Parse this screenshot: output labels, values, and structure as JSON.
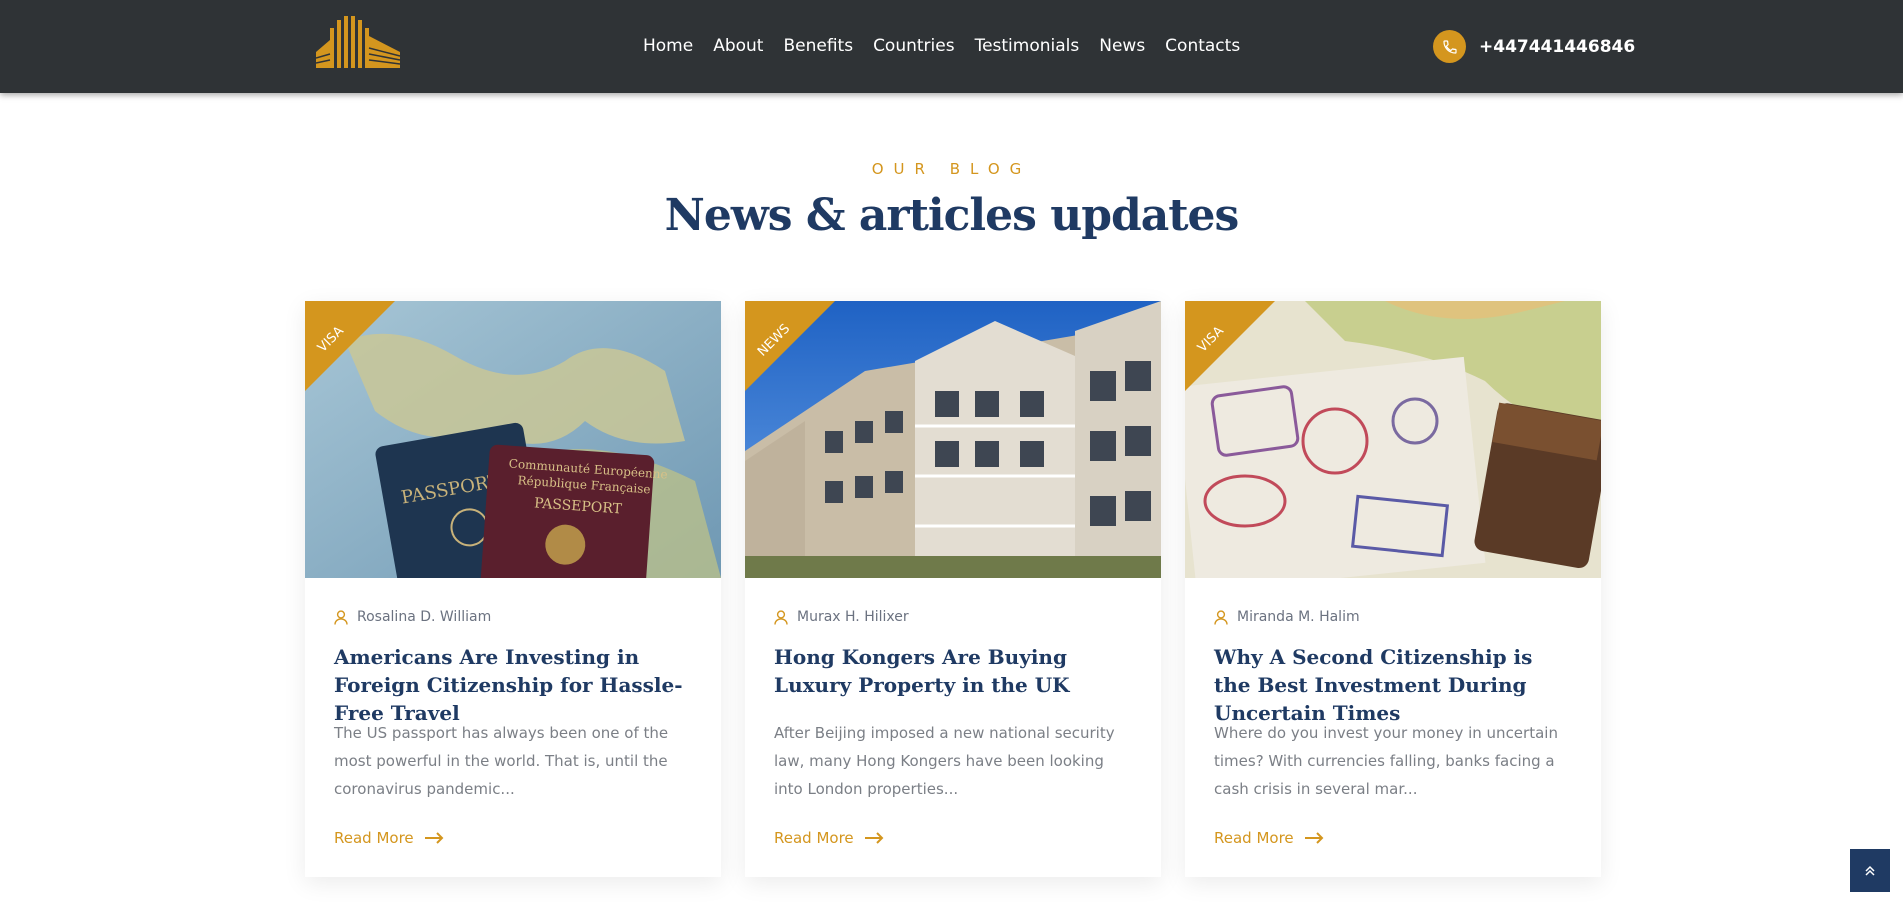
{
  "header": {
    "logo": "building-logo",
    "nav": [
      "Home",
      "About",
      "Benefits",
      "Countries",
      "Testimonials",
      "News",
      "Contacts"
    ],
    "phone": "+447441446846",
    "phone_icon": "phone-icon"
  },
  "section": {
    "eyebrow": "OUR BLOG",
    "title": "News & articles updates"
  },
  "posts": [
    {
      "tag": "VISA",
      "author": "Rosalina D. William",
      "title": "Americans Are Investing in Foreign Citizenship for Hassle-Free Travel",
      "excerpt": "The US passport has always been one of the most powerful in the world. That is, until the coronavirus pandemic...",
      "read_more": "Read More",
      "image_subject": "passports-on-map"
    },
    {
      "tag": "NEWS",
      "author": "Murax H. Hilixer",
      "title": "Hong Kongers Are Buying Luxury Property in the UK",
      "excerpt": "After Beijing imposed a new national security law, many Hong Kongers have been looking into London properties...",
      "read_more": "Read More",
      "image_subject": "apartment-building"
    },
    {
      "tag": "VISA",
      "author": "Miranda M. Halim",
      "title": "Why A Second Citizenship is the Best Investment During Uncertain Times",
      "excerpt": "Where do you invest your money in uncertain times? With currencies falling, banks facing a cash crisis in several mar...",
      "read_more": "Read More",
      "image_subject": "visa-stamps-on-map"
    }
  ],
  "colors": {
    "accent": "#d4961e",
    "navy": "#1f3a63",
    "header_bg": "#2f3336"
  },
  "scroll_top_icon": "chevrons-up-icon"
}
